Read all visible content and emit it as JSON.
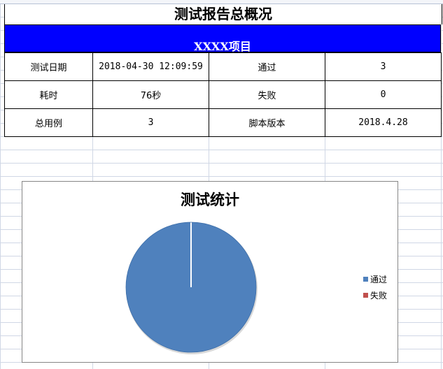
{
  "report": {
    "title": "测试报告总概况",
    "project": "XXXX项目"
  },
  "summary": {
    "rows": [
      {
        "label1": "测试日期",
        "value1": "2018-04-30 12:09:59",
        "label2": "通过",
        "value2": "3"
      },
      {
        "label1": "耗时",
        "value1": "76秒",
        "label2": "失败",
        "value2": "0"
      },
      {
        "label1": "总用例",
        "value1": "3",
        "label2": "脚本版本",
        "value2": "2018.4.28"
      }
    ]
  },
  "colors": {
    "project_bar": "#0000ff",
    "pass": "#4f81bd",
    "fail": "#c0504d"
  },
  "chart_data": {
    "type": "pie",
    "title": "测试统计",
    "categories": [
      "通过",
      "失败"
    ],
    "values": [
      3,
      0
    ],
    "colors": [
      "#4f81bd",
      "#c0504d"
    ],
    "legend": "right"
  }
}
